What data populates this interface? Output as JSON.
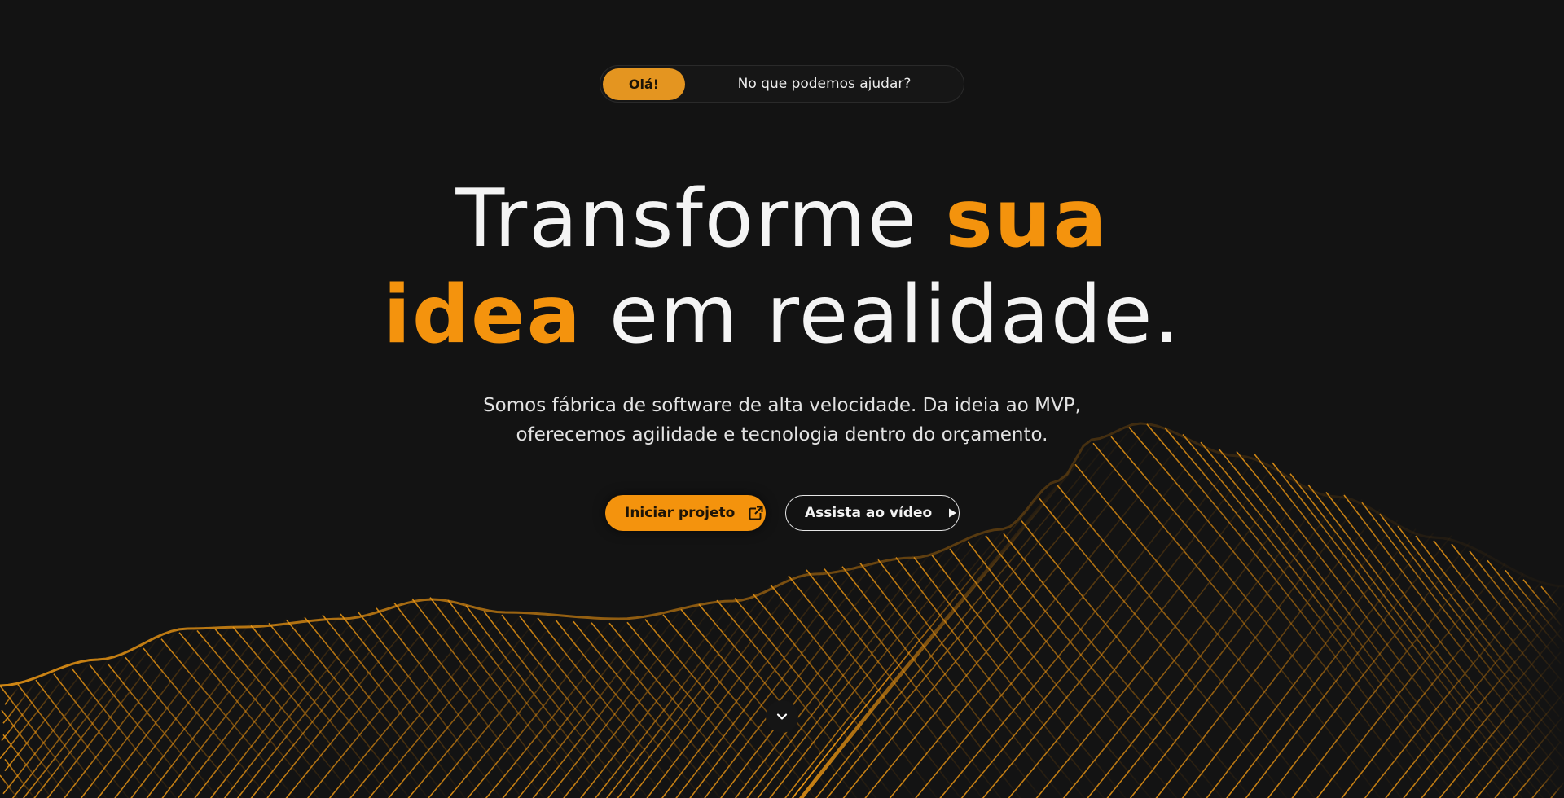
{
  "hero": {
    "pill": {
      "badge_label": "Olá!",
      "text": "No que podemos ajudar?"
    },
    "headline": {
      "part1": "Transforme ",
      "highlight1": "sua",
      "highlight2": "idea",
      "part2": " em realidade."
    },
    "subtitle": {
      "line1": "Somos fábrica de software de alta velocidade. Da ideia ao MVP,",
      "line2": "oferecemos agilidade e tecnologia dentro do orçamento."
    },
    "buttons": {
      "primary_label": "Iniciar projeto",
      "primary_icon": "external-link-icon",
      "secondary_label": "Assista ao vídeo",
      "secondary_icon": "play-icon"
    },
    "scroll_icon": "chevron-down-icon"
  },
  "colors": {
    "background": "#131313",
    "accent": "#f4930d",
    "badge": "#e49520",
    "text": "#f4f4f4"
  }
}
